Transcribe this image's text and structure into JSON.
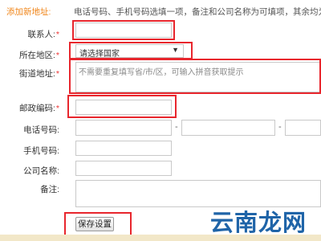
{
  "header": {
    "title": "添加新地址:",
    "note": "电话号码、手机号码选填一项，备注和公司名称为可填项，其余均为"
  },
  "form": {
    "contact_label": "联系人:",
    "region_label": "所在地区:",
    "region_value": "请选择国家",
    "street_label": "街道地址:",
    "street_placeholder": "不需要重复填写省/市/区，可输入拼音获取提示",
    "postcode_label": "邮政编码:",
    "phone_label": "电话号码:",
    "phone_separator": "-",
    "mobile_label": "手机号码:",
    "company_label": "公司名称:",
    "remark_label": "备注:",
    "required_mark": "*",
    "save_label": "保存设置"
  },
  "watermark": {
    "text": "云南龙网"
  },
  "colors": {
    "title": "#f08519",
    "required": "#e33333",
    "highlight": "#e8262d",
    "watermark": "#1f64a8"
  }
}
